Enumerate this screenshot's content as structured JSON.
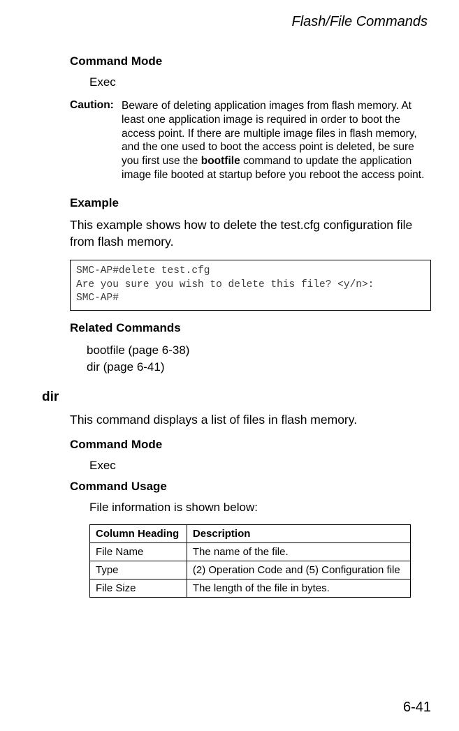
{
  "header": {
    "running_title": "Flash/File Commands"
  },
  "section1": {
    "command_mode_heading": "Command Mode",
    "command_mode_value": "Exec",
    "caution_label": "Caution:",
    "caution_text_pre": "Beware of deleting application images from flash memory. At least one application image is required in order to boot the access point. If there are multiple image files in flash memory, and the one used to boot the access point is deleted, be sure you first use the ",
    "caution_bold": "bootfile",
    "caution_text_post": " command to update the application image file booted at startup before you reboot the access point.",
    "example_heading": "Example",
    "example_text": "This example shows how to delete the test.cfg configuration file from flash memory.",
    "code_line1": "SMC-AP#delete test.cfg",
    "code_line2": "Are you sure you wish to delete this file? <y/n>:",
    "code_line3": "SMC-AP#",
    "related_heading": "Related Commands",
    "related_item1": "bootfile (page 6-38)",
    "related_item2": "dir (page 6-41)"
  },
  "section2": {
    "command_name": "dir",
    "description": "This command displays a list of files in flash memory.",
    "command_mode_heading": "Command Mode",
    "command_mode_value": "Exec",
    "command_usage_heading": "Command Usage",
    "usage_text": "File information is shown below:",
    "table": {
      "header_col1": "Column Heading",
      "header_col2": "Description",
      "rows": [
        {
          "c1": "File Name",
          "c2": "The name of the file."
        },
        {
          "c1": "Type",
          "c2": "(2) Operation Code and (5) Configuration file"
        },
        {
          "c1": "File Size",
          "c2": "The length of the file in bytes."
        }
      ]
    }
  },
  "page_number": "6-41"
}
